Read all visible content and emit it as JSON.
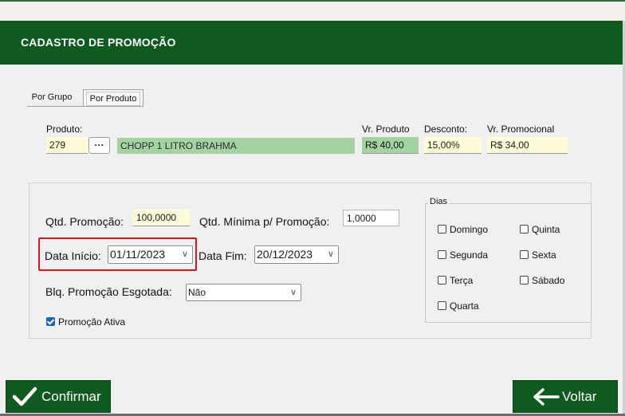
{
  "window": {
    "title": "CADASTRO DE PROMOÇÃO"
  },
  "tabs": [
    {
      "label": "Por Grupo",
      "active": false
    },
    {
      "label": "Por Produto",
      "active": true
    }
  ],
  "produto": {
    "label": "Produto:",
    "code": "279",
    "search_button": "···",
    "name": "CHOPP 1 LITRO BRAHMA",
    "vr_produto_label": "Vr. Produto",
    "vr_produto": "R$ 40,00",
    "desconto_label": "Desconto:",
    "desconto": "15,00%",
    "vr_promocional_label": "Vr. Promocional",
    "vr_promocional": "R$ 34,00"
  },
  "form": {
    "qtd_promocao_label": "Qtd. Promoção:",
    "qtd_promocao": "100,0000",
    "qtd_minima_label": "Qtd. Mínima p/ Promoção:",
    "qtd_minima": "1,0000",
    "data_inicio_label": "Data Início:",
    "data_inicio": "01/11/2023",
    "data_fim_label": "Data Fim:",
    "data_fim": "20/12/2023",
    "blq_label": "Blq. Promoção Esgotada:",
    "blq_value": "Não",
    "ativa_label": "Promoção Ativa",
    "ativa_checked": true
  },
  "dias": {
    "title": "Dias",
    "items": [
      {
        "label": "Domingo",
        "checked": false
      },
      {
        "label": "Segunda",
        "checked": false
      },
      {
        "label": "Terça",
        "checked": false
      },
      {
        "label": "Quarta",
        "checked": false
      },
      {
        "label": "Quinta",
        "checked": false
      },
      {
        "label": "Sexta",
        "checked": false
      },
      {
        "label": "Sábado",
        "checked": false
      }
    ]
  },
  "buttons": {
    "confirm": "Confirmar",
    "voltar": "Voltar"
  },
  "colors": {
    "header": "#0f5a1e",
    "highlight_border": "#e0141e",
    "readonly_green": "#a3d3a1",
    "input_yellow": "#fdfbd8"
  },
  "icons": {
    "confirm": "checkmark-icon",
    "voltar": "arrow-left-icon",
    "dropdown": "chevron-down-icon"
  }
}
